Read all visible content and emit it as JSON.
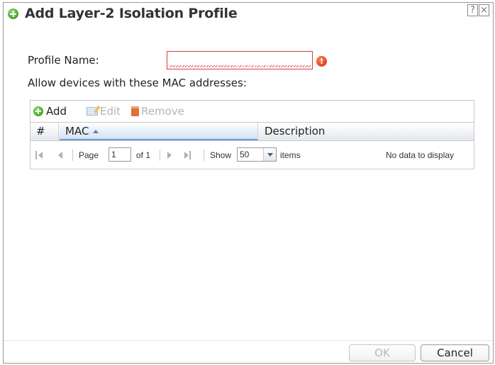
{
  "dialog": {
    "title": "Add Layer-2 Isolation Profile",
    "help_label": "?",
    "close_label": "×"
  },
  "form": {
    "profile_name_label": "Profile Name:",
    "profile_name_value": "",
    "warning_glyph": "!",
    "allow_label": "Allow devices with these MAC addresses:"
  },
  "toolbar": {
    "add_label": "Add",
    "edit_label": "Edit",
    "remove_label": "Remove"
  },
  "table": {
    "columns": [
      "#",
      "MAC",
      "Description"
    ],
    "sorted_column": "MAC",
    "rows": []
  },
  "pager": {
    "page_label": "Page",
    "page_value": "1",
    "of_label": "of 1",
    "show_label": "Show",
    "show_value": "50",
    "items_label": "items",
    "empty_message": "No data to display"
  },
  "buttons": {
    "ok_label": "OK",
    "cancel_label": "Cancel"
  },
  "colors": {
    "accent_green": "#3fa21d",
    "error_red": "#d43d3d",
    "sort_blue": "#6a9bd8"
  }
}
